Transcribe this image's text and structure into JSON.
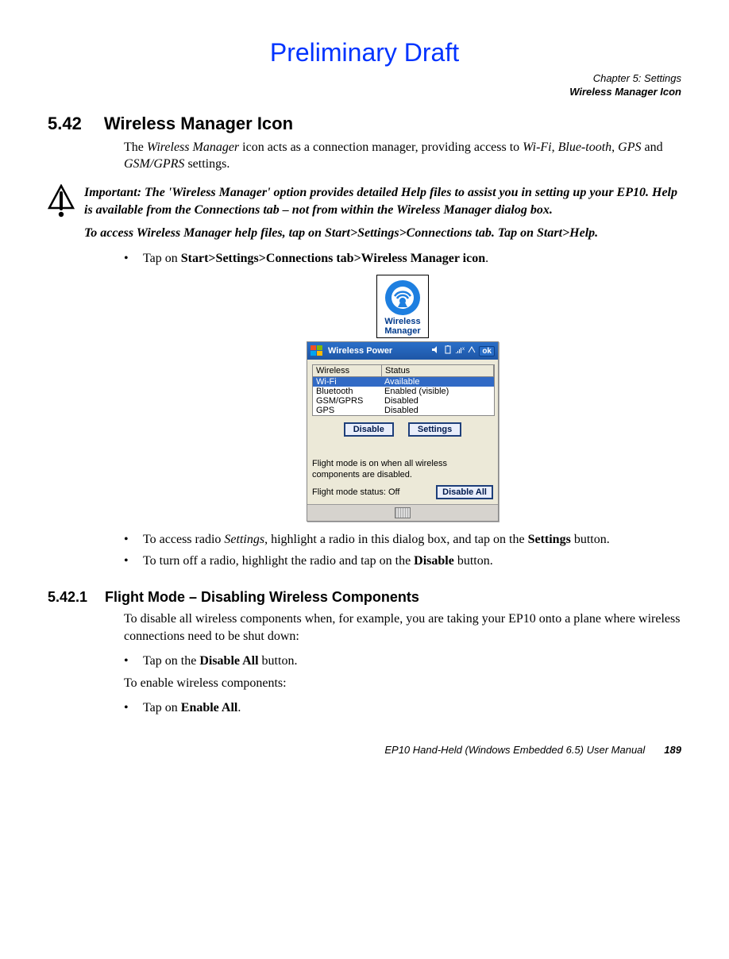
{
  "preliminary": "Preliminary Draft",
  "chapter_line1": "Chapter 5:  Settings",
  "chapter_line2": "Wireless Manager Icon",
  "section": {
    "num": "5.42",
    "title": "Wireless Manager Icon",
    "intro_a": "The ",
    "intro_b_em": "Wireless Manager",
    "intro_c": " icon acts as a connection manager, providing access to ",
    "intro_d_em": "Wi-Fi",
    "intro_e": ", ",
    "intro_f_em": "Blue-tooth",
    "intro_g": ", ",
    "intro_h_em": "GPS",
    "intro_i": " and ",
    "intro_j_em": "GSM/GPRS",
    "intro_k": " settings."
  },
  "important": {
    "label": "Important:  ",
    "p1": "The 'Wireless Manager' option provides detailed Help files to assist you in setting up your EP10. Help is available from the Connections tab – not from within the Wireless Manager dialog box.",
    "p2": "To access Wireless Manager help files, tap on Start>Settings>Connections tab. Tap on Start>Help."
  },
  "step1": {
    "a": "Tap on ",
    "b_bold": "Start>Settings>Connections tab>Wireless Manager icon",
    "c": "."
  },
  "icon_label_l1": "Wireless",
  "icon_label_l2": "Manager",
  "device": {
    "title": "Wireless Power",
    "ok": "ok",
    "columns": {
      "c1": "Wireless",
      "c2": "Status"
    },
    "rows": [
      {
        "name": "Wi-Fi",
        "status": "Available",
        "selected": true
      },
      {
        "name": "Bluetooth",
        "status": "Enabled (visible)",
        "selected": false
      },
      {
        "name": "GSM/GPRS",
        "status": "Disabled",
        "selected": false
      },
      {
        "name": "GPS",
        "status": "Disabled",
        "selected": false
      }
    ],
    "btn_disable": "Disable",
    "btn_settings": "Settings",
    "flight_note": "Flight mode is on when all wireless components are disabled.",
    "flight_status_label": "Flight mode status: Off",
    "btn_disable_all": "Disable All"
  },
  "after_fig": {
    "li1_a": "To access radio ",
    "li1_b_em": "Settings",
    "li1_c": ", highlight a radio in this dialog box, and tap on the ",
    "li1_d_bold": "Settings",
    "li1_e": " button.",
    "li2_a": "To turn off a radio, highlight the radio and tap on the ",
    "li2_b_bold": "Disable",
    "li2_c": " button."
  },
  "subsection": {
    "num": "5.42.1",
    "title": "Flight Mode – Disabling Wireless Components",
    "intro": "To disable all wireless components when, for example, you are taking your EP10 onto a plane where wireless connections need to be shut down:",
    "li1_a": "Tap on the ",
    "li1_b_bold": "Disable All",
    "li1_c": " button.",
    "enable_intro": "To enable wireless components:",
    "li2_a": "Tap on ",
    "li2_b_bold": "Enable All",
    "li2_c": "."
  },
  "footer": {
    "manual": "EP10 Hand-Held (Windows Embedded 6.5) User Manual",
    "page": "189"
  }
}
